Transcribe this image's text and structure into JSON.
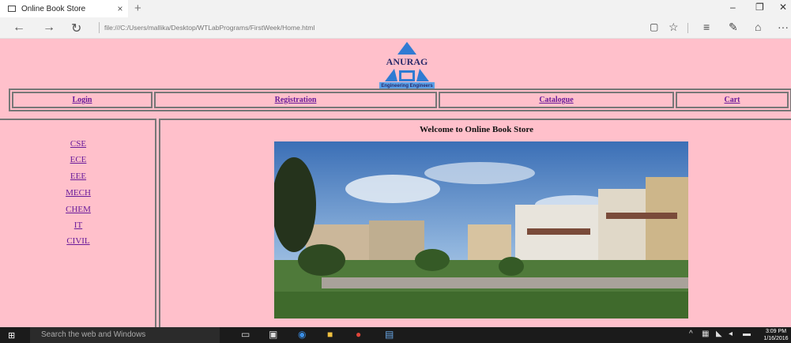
{
  "browser": {
    "tab_title": "Online Book Store",
    "tab_close": "×",
    "new_tab": "+",
    "url": "file:///C:/Users/mallika/Desktop/WTLabPrograms/FirstWeek/Home.html",
    "nav": {
      "back": "←",
      "forward": "→",
      "refresh": "↻"
    },
    "window": {
      "minimize": "–",
      "restore": "❐",
      "close": "✕"
    },
    "toolbar": {
      "reading": "▢",
      "favorite": "☆",
      "hub": "≡",
      "note": "✎",
      "share": "⌂",
      "more": "···"
    }
  },
  "logo": {
    "title": "ANURAG",
    "subtitle": "Engineering Engineers",
    "color": "#2f7bd3"
  },
  "nav_links": [
    "Login",
    "Registration",
    "Catalogue",
    "Cart"
  ],
  "sidebar_links": [
    "CSE",
    "ECE",
    "EEE",
    "MECH",
    "CHEM",
    "IT",
    "CIVIL"
  ],
  "content": {
    "welcome": "Welcome to Online Book Store"
  },
  "taskbar": {
    "start_icon": "⊞",
    "search_placeholder": "Search the web and Windows",
    "time": "3:09 PM",
    "date": "1/16/2016"
  },
  "colors": {
    "page_bg": "#ffc0cb",
    "link": "#6a1b9a",
    "border": "#777777"
  }
}
